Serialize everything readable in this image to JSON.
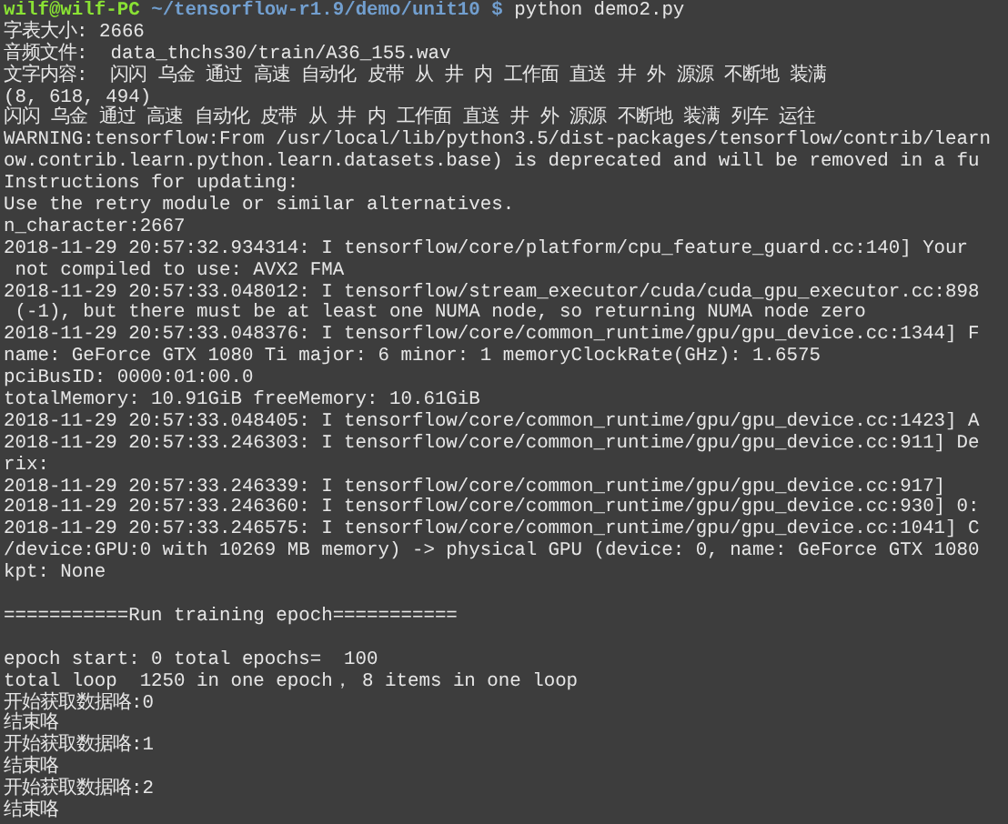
{
  "terminal": {
    "lines": [
      {
        "kind": "prompt",
        "user": "wilf@wilf-PC",
        "path": "~/tensorflow-r1.9/demo/unit10 $",
        "command": "python demo2.py"
      },
      {
        "kind": "output",
        "text": "字表大小: 2666"
      },
      {
        "kind": "output",
        "text": "音频文件:  data_thchs30/train/A36_155.wav"
      },
      {
        "kind": "output",
        "text": "文字内容:  闪闪 乌金 通过 高速 自动化 皮带 从 井 内 工作面 直送 井 外 源源 不断地 装满"
      },
      {
        "kind": "output",
        "text": "(8, 618, 494)"
      },
      {
        "kind": "output",
        "text": "闪闪 乌金 通过 高速 自动化 皮带 从 井 内 工作面 直送 井 外 源源 不断地 装满 列车 运往"
      },
      {
        "kind": "output",
        "text": "WARNING:tensorflow:From /usr/local/lib/python3.5/dist-packages/tensorflow/contrib/learn"
      },
      {
        "kind": "output",
        "text": "ow.contrib.learn.python.learn.datasets.base) is deprecated and will be removed in a fu"
      },
      {
        "kind": "output",
        "text": "Instructions for updating:"
      },
      {
        "kind": "output",
        "text": "Use the retry module or similar alternatives."
      },
      {
        "kind": "output",
        "text": "n_character:2667"
      },
      {
        "kind": "output",
        "text": "2018-11-29 20:57:32.934314: I tensorflow/core/platform/cpu_feature_guard.cc:140] Your"
      },
      {
        "kind": "output",
        "text": " not compiled to use: AVX2 FMA"
      },
      {
        "kind": "output",
        "text": "2018-11-29 20:57:33.048012: I tensorflow/stream_executor/cuda/cuda_gpu_executor.cc:898"
      },
      {
        "kind": "output",
        "text": " (-1), but there must be at least one NUMA node, so returning NUMA node zero"
      },
      {
        "kind": "output",
        "text": "2018-11-29 20:57:33.048376: I tensorflow/core/common_runtime/gpu/gpu_device.cc:1344] F"
      },
      {
        "kind": "output",
        "text": "name: GeForce GTX 1080 Ti major: 6 minor: 1 memoryClockRate(GHz): 1.6575"
      },
      {
        "kind": "output",
        "text": "pciBusID: 0000:01:00.0"
      },
      {
        "kind": "output",
        "text": "totalMemory: 10.91GiB freeMemory: 10.61GiB"
      },
      {
        "kind": "output",
        "text": "2018-11-29 20:57:33.048405: I tensorflow/core/common_runtime/gpu/gpu_device.cc:1423] A"
      },
      {
        "kind": "output",
        "text": "2018-11-29 20:57:33.246303: I tensorflow/core/common_runtime/gpu/gpu_device.cc:911] De"
      },
      {
        "kind": "output",
        "text": "rix:"
      },
      {
        "kind": "output",
        "text": "2018-11-29 20:57:33.246339: I tensorflow/core/common_runtime/gpu/gpu_device.cc:917]"
      },
      {
        "kind": "output",
        "text": "2018-11-29 20:57:33.246360: I tensorflow/core/common_runtime/gpu/gpu_device.cc:930] 0:"
      },
      {
        "kind": "output",
        "text": "2018-11-29 20:57:33.246575: I tensorflow/core/common_runtime/gpu/gpu_device.cc:1041] C"
      },
      {
        "kind": "output",
        "text": "/device:GPU:0 with 10269 MB memory) -> physical GPU (device: 0, name: GeForce GTX 1080"
      },
      {
        "kind": "output",
        "text": "kpt: None"
      },
      {
        "kind": "blank"
      },
      {
        "kind": "output",
        "text": "===========Run training epoch==========="
      },
      {
        "kind": "blank"
      },
      {
        "kind": "output",
        "text": "epoch start: 0 total epochs=  100"
      },
      {
        "kind": "output",
        "text": "total loop  1250 in one epoch， 8 items in one loop"
      },
      {
        "kind": "output",
        "text": "开始获取数据咯:0"
      },
      {
        "kind": "output",
        "text": "结束咯"
      },
      {
        "kind": "output",
        "text": "开始获取数据咯:1"
      },
      {
        "kind": "output",
        "text": "结束咯"
      },
      {
        "kind": "output",
        "text": "开始获取数据咯:2"
      },
      {
        "kind": "output",
        "text": "结束咯"
      }
    ]
  }
}
